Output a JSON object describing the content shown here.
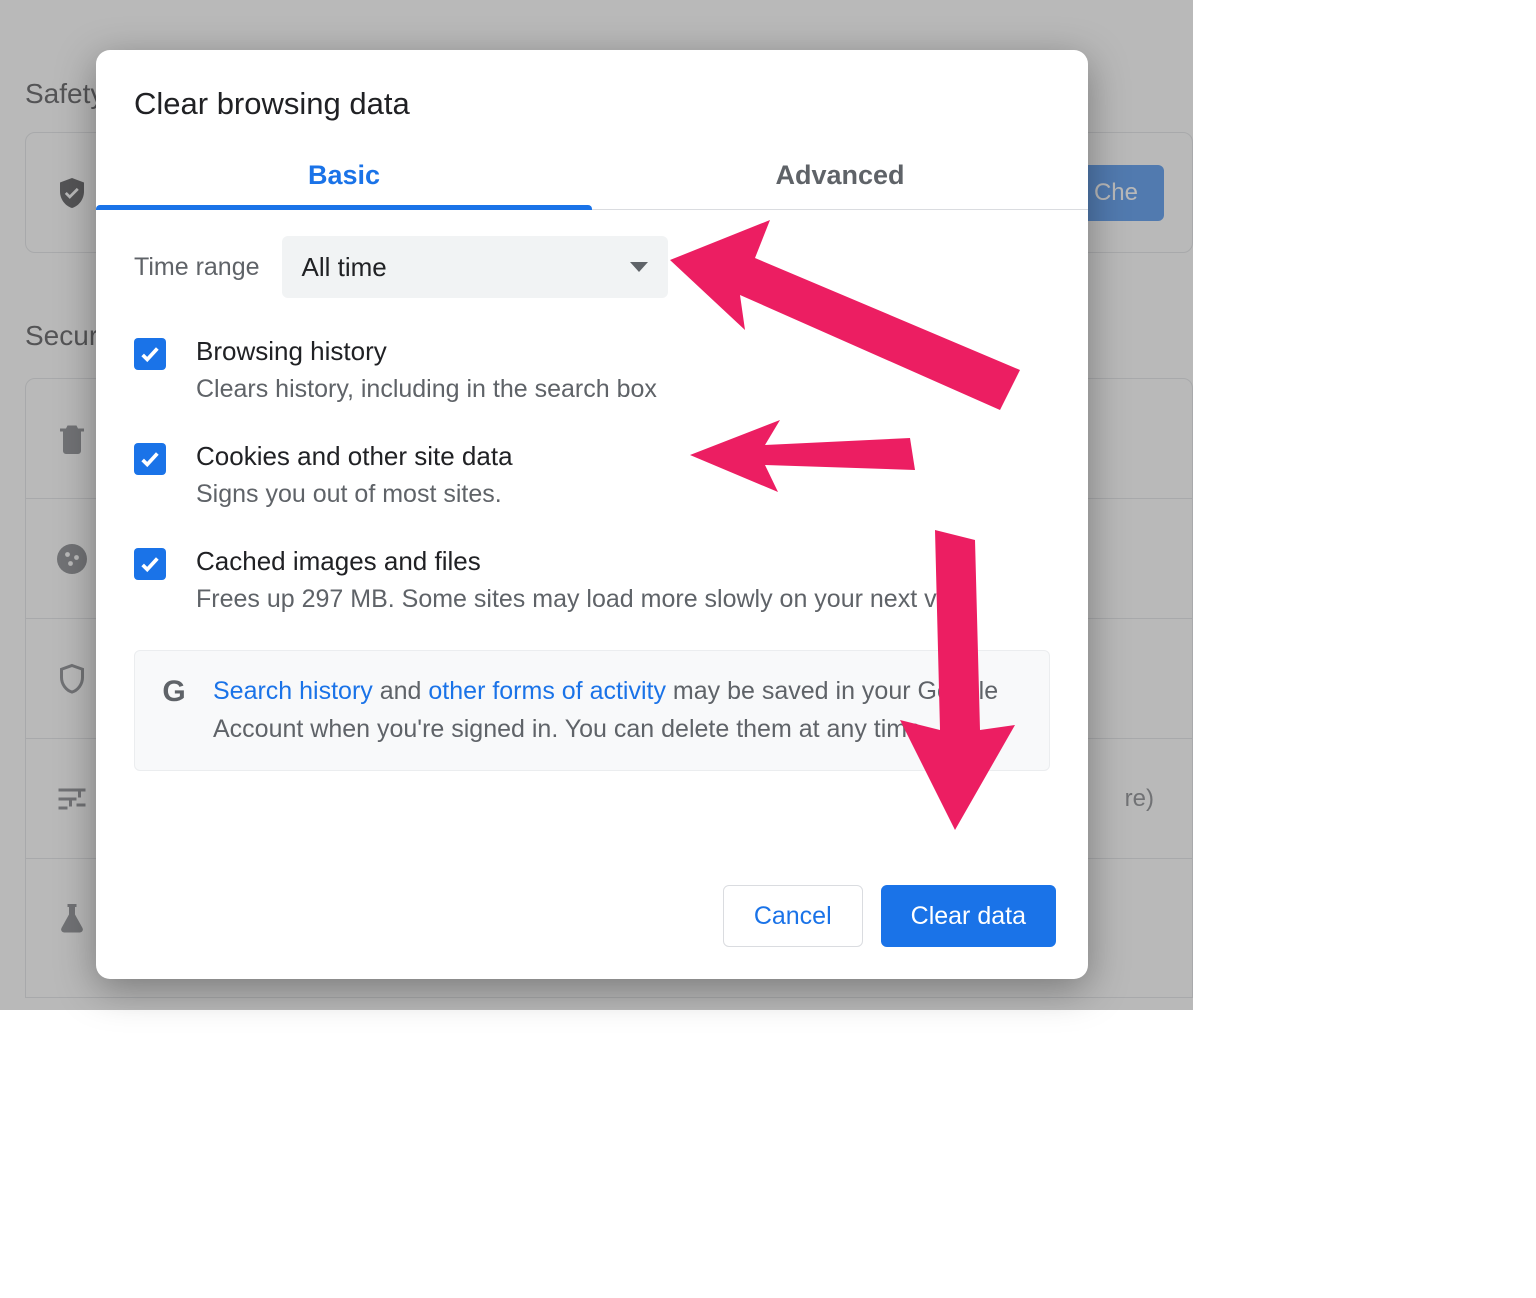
{
  "background": {
    "safety_heading": "Safety",
    "security_heading": "Secur",
    "check_button": "Che",
    "row_more_suffix": "re)"
  },
  "dialog": {
    "title": "Clear browsing data",
    "tabs": {
      "basic": "Basic",
      "advanced": "Advanced"
    },
    "time_range": {
      "label": "Time range",
      "value": "All time"
    },
    "options": [
      {
        "title": "Browsing history",
        "desc": "Clears history, including in the search box",
        "checked": true
      },
      {
        "title": "Cookies and other site data",
        "desc": "Signs you out of most sites.",
        "checked": true
      },
      {
        "title": "Cached images and files",
        "desc": "Frees up 297 MB. Some sites may load more slowly on your next visit.",
        "checked": true
      }
    ],
    "info": {
      "link1": "Search history",
      "mid1": " and ",
      "link2": "other forms of activity",
      "rest": " may be saved in your Google Account when you're signed in. You can delete them at any time."
    },
    "buttons": {
      "cancel": "Cancel",
      "clear": "Clear data"
    }
  }
}
